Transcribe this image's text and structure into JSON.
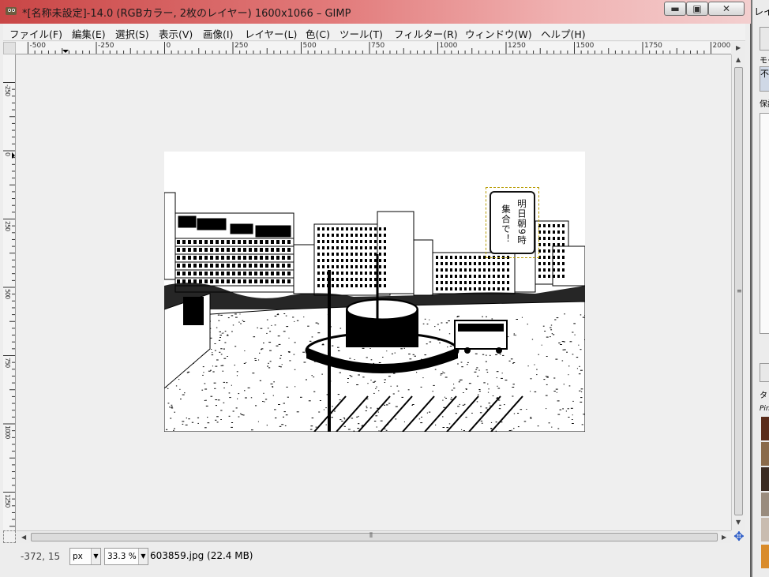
{
  "window": {
    "title": "*[名称未設定]-14.0 (RGBカラー, 2枚のレイヤー) 1600x1066 – GIMP",
    "min_label": "▬",
    "max_label": "▣",
    "close_label": "✕"
  },
  "menu": [
    "ファイル(F)",
    "編集(E)",
    "選択(S)",
    "表示(V)",
    "画像(I)",
    "レイヤー(L)",
    "色(C)",
    "ツール(T)",
    "フィルター(R)",
    "ウィンドウ(W)",
    "ヘルプ(H)"
  ],
  "ruler": {
    "h_labels": [
      "-500",
      "-250",
      "0",
      "250",
      "500",
      "750",
      "1000",
      "1250",
      "1500",
      "1750",
      "2000"
    ],
    "v_labels": [
      "-250",
      "0",
      "250",
      "500",
      "750",
      "1000",
      "1250"
    ]
  },
  "image": {
    "speech_line1": "明日朝9時",
    "speech_line2": "集合で！"
  },
  "status": {
    "coords": "-372, 15",
    "unit": "px",
    "zoom": "33.3 %",
    "file_info": "603859.jpg (22.4 MB)"
  },
  "dock": {
    "title": "レイ",
    "mode_label": "モー",
    "mode_value": "不",
    "lock_label": "保護",
    "filter_label": "タ",
    "brush_name": "Pin"
  },
  "colors": {
    "title_gradient_start": "#c94646",
    "canvas_bg": "#efefef",
    "bubble_guide": "#b79b00",
    "nav_icon": "#2a5bc8"
  }
}
